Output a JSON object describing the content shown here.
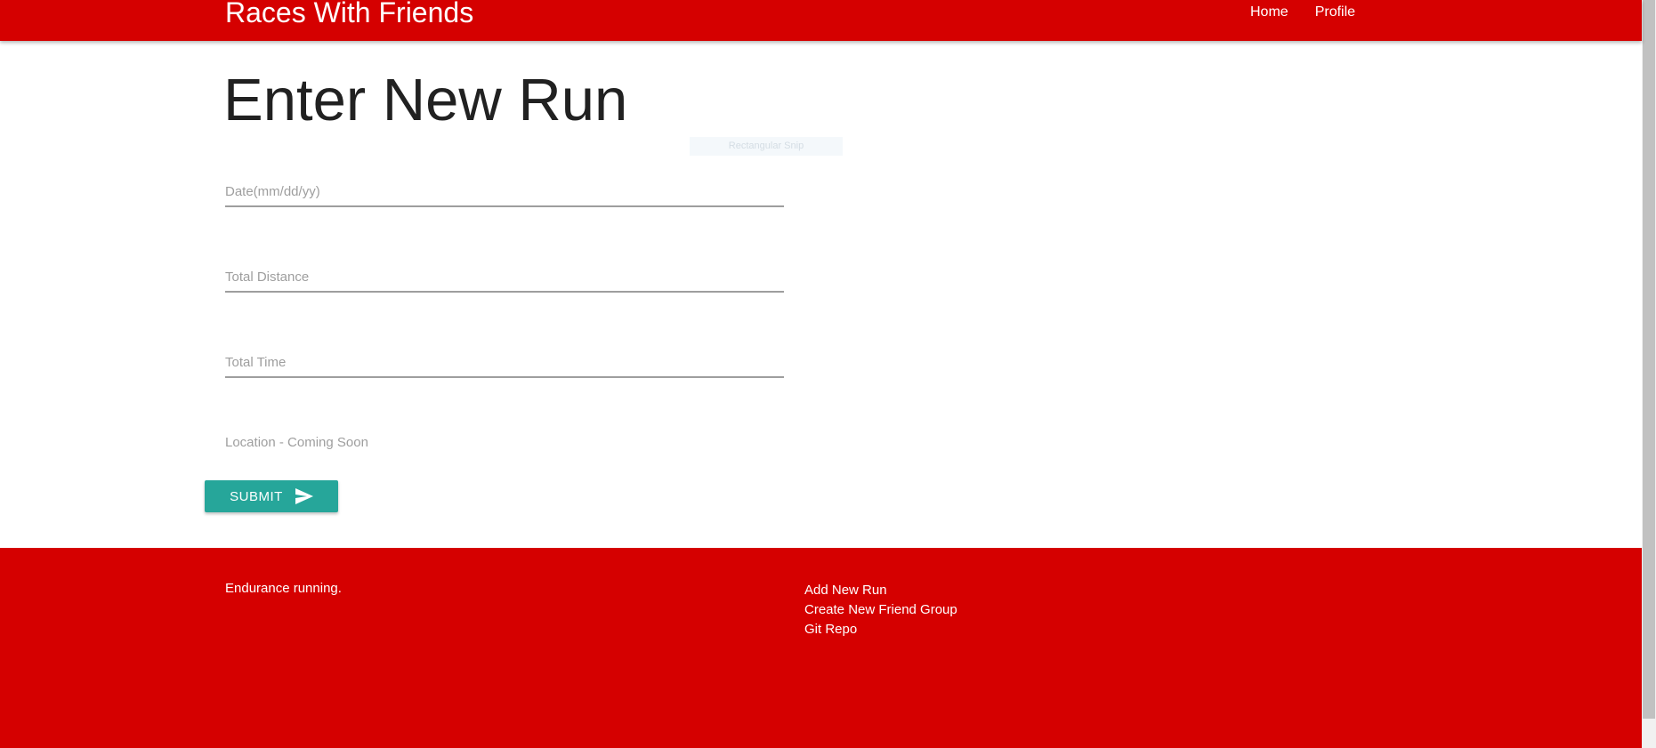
{
  "navbar": {
    "brand": "Races With Friends",
    "links": [
      {
        "label": "Home"
      },
      {
        "label": "Profile"
      }
    ]
  },
  "main": {
    "title": "Enter New Run",
    "ghost_strip": "Rectangular Snip",
    "fields": {
      "date": {
        "placeholder": "Date(mm/dd/yy)",
        "value": ""
      },
      "distance": {
        "placeholder": "Total Distance",
        "value": ""
      },
      "time": {
        "placeholder": "Total Time",
        "value": ""
      }
    },
    "location_label": "Location - Coming Soon",
    "submit_label": "SUBMIT",
    "submit_icon": "send-icon"
  },
  "footer": {
    "text": "Endurance running.",
    "links": [
      {
        "label": "Add New Run"
      },
      {
        "label": "Create New Friend Group"
      },
      {
        "label": "Git Repo"
      }
    ]
  },
  "colors": {
    "primary": "#d50000",
    "accent": "#26a69a",
    "title_text": "#212121",
    "placeholder": "#9e9e9e"
  }
}
